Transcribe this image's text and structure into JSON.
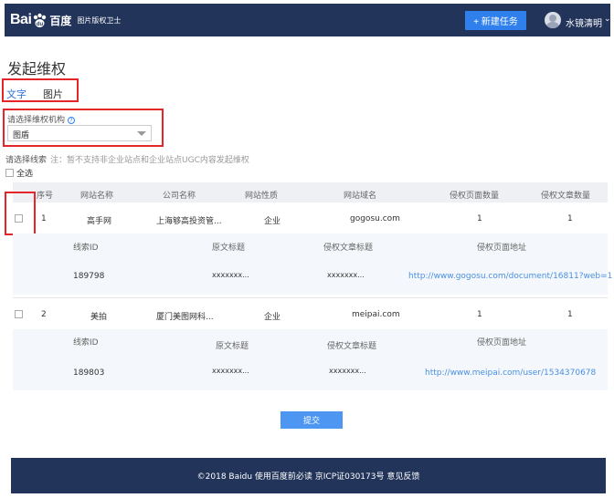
{
  "header": {
    "logo_text_1": "Bai",
    "logo_text_2": "百度",
    "logo_sub": "图片版权卫士",
    "new_task_label": "+ 新建任务",
    "username": "水镜清明",
    "chevron": "⌄"
  },
  "page": {
    "title": "发起维权",
    "tabs": [
      {
        "label": "文字"
      },
      {
        "label": "图片"
      }
    ],
    "org_label": "请选择维权机构",
    "org_selected": "图盾",
    "clue_label": "请选择线索",
    "clue_note": "注：暂不支持非企业站点和企业站点UGC内容发起维权",
    "select_all": "全选"
  },
  "table": {
    "headers": [
      "序号",
      "网站名称",
      "公司名称",
      "网站性质",
      "网站域名",
      "侵权页面数量",
      "侵权文章数量"
    ],
    "sub_headers": [
      "线索ID",
      "原文标题",
      "侵权文章标题",
      "侵权页面地址"
    ],
    "rows": [
      {
        "index": "1",
        "site": "高手网",
        "company": "上海够高投资管...",
        "nature": "企业",
        "domain": "gogosu.com",
        "pages": "1",
        "articles": "1",
        "clue_id": "189798",
        "orig_title": "xxxxxxx...",
        "inf_title": "xxxxxxx...",
        "url": "http://www.gogosu.com/document/16811?web=1"
      },
      {
        "index": "2",
        "site": "美拍",
        "company": "厦门美图网科...",
        "nature": "企业",
        "domain": "meipai.com",
        "pages": "1",
        "articles": "1",
        "clue_id": "189803",
        "orig_title": "xxxxxxx...",
        "inf_title": "xxxxxxx...",
        "url": "http://www.meipai.com/user/1534370678"
      }
    ]
  },
  "submit_label": "提交",
  "footer": "©2018 Baidu 使用百度前必读 京ICP证030173号 意见反馈",
  "colors": {
    "header_bg": "#22345a",
    "accent": "#2f80ed",
    "highlight_border": "#e4262b",
    "link": "#4a90e2"
  }
}
